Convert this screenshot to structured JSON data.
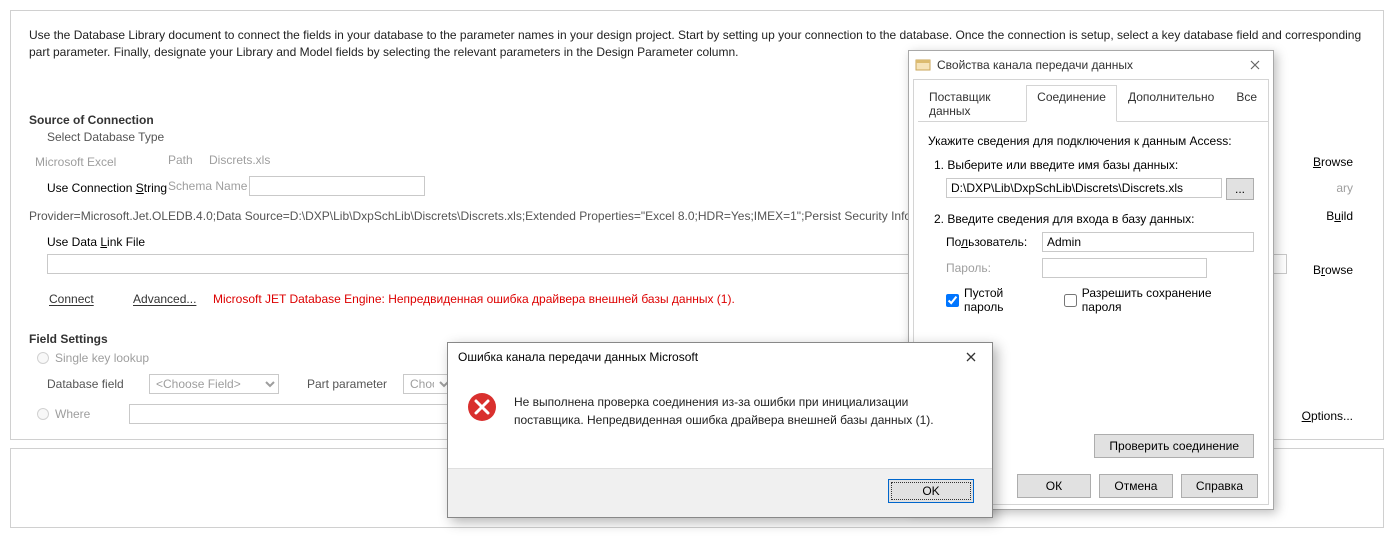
{
  "intro": "Use the Database Library document to connect the fields in your database to the parameter names in your design project. Start by setting up your connection to the database. Once the connection is setup, select a key database field and corresponding part parameter. Finally, designate your Library and Model fields by selecting the relevant parameters in the Design Parameter column.",
  "source_of_connection": "Source of Connection",
  "select_db_type": "Select Database Type",
  "ms_excel": "Microsoft Excel",
  "path_label": "Path",
  "path_value": "Discrets.xls",
  "use_conn_string": "Use Connection String",
  "schema_name": "Schema Name",
  "provider_string": "Provider=Microsoft.Jet.OLEDB.4.0;Data Source=D:\\DXP\\Lib\\DxpSchLib\\Discrets\\Discrets.xls;Extended Properties=\"Excel 8.0;HDR=Yes;IMEX=1\";Persist Security Info=False",
  "use_data_link_file": "Use Data Link File",
  "connect": "Connect",
  "advanced": "Advanced...",
  "jet_error": "Microsoft JET Database Engine: Непредвиденная ошибка драйвера внешней базы данных (1).",
  "field_settings": "Field Settings",
  "single_key_lookup": "Single key lookup",
  "database_field": "Database field",
  "choose_field": "<Choose Field>",
  "part_parameter": "Part parameter",
  "choose_parameter": "Choose Parameter",
  "where_label": "Where",
  "options": "Options...",
  "browse_link": "Browse",
  "build_link": "Build",
  "right_browse2": "Browse",
  "right_ary": "ary",
  "propsDialog": {
    "title": "Свойства канала передачи данных",
    "tabs": {
      "provider": "Поставщик данных",
      "connection": "Соединение",
      "advanced": "Дополнительно",
      "all": "Все"
    },
    "info": "Укажите сведения для подключения к данным Access:",
    "step1": "1. Выберите или введите имя базы данных:",
    "db_path": "D:\\DXP\\Lib\\DxpSchLib\\Discrets\\Discrets.xls",
    "browse_dots": "...",
    "step2": "2. Введите сведения для входа в базу данных:",
    "user_label": "Пользователь:",
    "user_value": "Admin",
    "pass_label": "Пароль:",
    "empty_pass": "Пустой пароль",
    "allow_save": "Разрешить сохранение пароля",
    "test_conn": "Проверить соединение",
    "ok": "ОК",
    "cancel": "Отмена",
    "help": "Справка"
  },
  "errDialog": {
    "title": "Ошибка канала передачи данных Microsoft",
    "message": "Не выполнена проверка соединения из-за ошибки при инициализации поставщика. Непредвиденная ошибка драйвера внешней базы данных (1).",
    "ok": "OK"
  }
}
